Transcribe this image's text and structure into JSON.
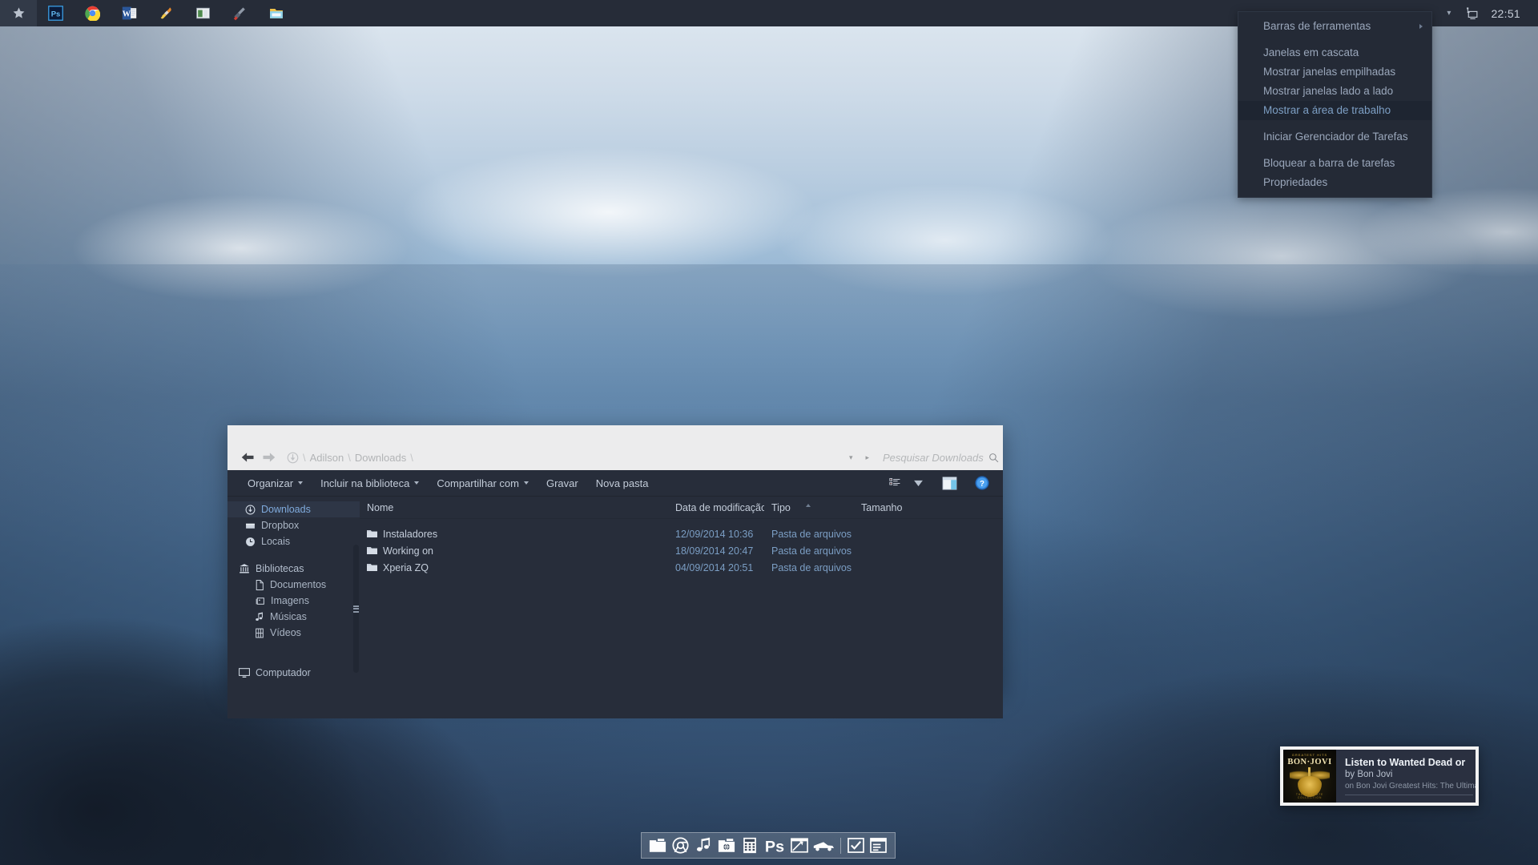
{
  "taskbar": {
    "icons": [
      {
        "name": "star-icon",
        "label": "Star"
      },
      {
        "name": "photoshop-icon",
        "label": "Adobe Photoshop"
      },
      {
        "name": "chrome-icon",
        "label": "Google Chrome"
      },
      {
        "name": "word-icon",
        "label": "Microsoft Word"
      },
      {
        "name": "paint-brush-icon",
        "label": "Paint"
      },
      {
        "name": "window-app-icon",
        "label": "Application"
      },
      {
        "name": "tools-icon",
        "label": "Tools"
      },
      {
        "name": "folder-explorer-icon",
        "label": "Windows Explorer"
      }
    ],
    "tray": {
      "show_hidden_label": "▾",
      "network_icon": "network-icon",
      "clock": "22:51"
    }
  },
  "context_menu": {
    "items": [
      {
        "label": "Barras de ferramentas",
        "submenu": true,
        "selected": false,
        "sep_after": true
      },
      {
        "label": "Janelas em cascata",
        "submenu": false,
        "selected": false,
        "sep_after": false
      },
      {
        "label": "Mostrar janelas empilhadas",
        "submenu": false,
        "selected": false,
        "sep_after": false
      },
      {
        "label": "Mostrar janelas lado a lado",
        "submenu": false,
        "selected": false,
        "sep_after": false
      },
      {
        "label": "Mostrar a área de trabalho",
        "submenu": false,
        "selected": true,
        "sep_after": true
      },
      {
        "label": "Iniciar Gerenciador de Tarefas",
        "submenu": false,
        "selected": false,
        "sep_after": true
      },
      {
        "label": "Bloquear a barra de tarefas",
        "submenu": false,
        "selected": false,
        "sep_after": false
      },
      {
        "label": "Propriedades",
        "submenu": false,
        "selected": false,
        "sep_after": false
      }
    ]
  },
  "explorer": {
    "address": {
      "back_icon": "back-arrow-icon",
      "forward_icon": "forward-arrow-icon",
      "location_icon": "downloads-icon",
      "crumbs": [
        "Adilson",
        "Downloads"
      ],
      "separator": "\\"
    },
    "search": {
      "placeholder": "Pesquisar Downloads",
      "icon": "search-icon"
    },
    "toolbar": {
      "buttons": [
        {
          "label": "Organizar",
          "caret": true
        },
        {
          "label": "Incluir na biblioteca",
          "caret": true
        },
        {
          "label": "Compartilhar com",
          "caret": true
        },
        {
          "label": "Gravar",
          "caret": false
        },
        {
          "label": "Nova pasta",
          "caret": false
        }
      ],
      "view_icon": "view-options-icon",
      "view_caret": "▾",
      "preview_icon": "preview-pane-icon",
      "help_icon": "help-icon"
    },
    "sidebar": {
      "items": [
        {
          "label": "Downloads",
          "icon": "download-circle-icon",
          "active": true,
          "indent": false,
          "head": false
        },
        {
          "label": "Dropbox",
          "icon": "dropbox-folder-icon",
          "active": false,
          "indent": false,
          "head": false
        },
        {
          "label": "Locais",
          "icon": "clock-icon",
          "active": false,
          "indent": false,
          "head": false
        },
        {
          "label": "Bibliotecas",
          "icon": "library-icon",
          "active": false,
          "indent": false,
          "head": true
        },
        {
          "label": "Documentos",
          "icon": "document-icon",
          "active": false,
          "indent": true,
          "head": false
        },
        {
          "label": "Imagens",
          "icon": "picture-icon",
          "active": false,
          "indent": true,
          "head": false
        },
        {
          "label": "Músicas",
          "icon": "music-note-icon",
          "active": false,
          "indent": true,
          "head": false
        },
        {
          "label": "Vídeos",
          "icon": "film-icon",
          "active": false,
          "indent": true,
          "head": false
        },
        {
          "label": "Computador",
          "icon": "computer-icon",
          "active": false,
          "indent": false,
          "head": true
        }
      ]
    },
    "columns": [
      {
        "key": "name",
        "label": "Nome",
        "sorted": false
      },
      {
        "key": "date",
        "label": "Data de modificação",
        "sorted": false
      },
      {
        "key": "type",
        "label": "Tipo",
        "sorted": true
      },
      {
        "key": "size",
        "label": "Tamanho",
        "sorted": false
      }
    ],
    "files": [
      {
        "name": "Instaladores",
        "date": "12/09/2014 10:36",
        "type": "Pasta de arquivos",
        "size": "",
        "icon": "folder-icon"
      },
      {
        "name": "Working on",
        "date": "18/09/2014 20:47",
        "type": "Pasta de arquivos",
        "size": "",
        "icon": "folder-icon"
      },
      {
        "name": "Xperia ZQ",
        "date": "04/09/2014 20:51",
        "type": "Pasta de arquivos",
        "size": "",
        "icon": "folder-icon"
      }
    ]
  },
  "notification": {
    "album_art": {
      "top_text": "GREATEST HITS",
      "artist_text": "BON·JOVI",
      "bottom_text": "THE ULTIMATE COLLECTION"
    },
    "title": "Listen to Wanted Dead or",
    "artist": "by Bon Jovi",
    "album": "on Bon Jovi Greatest Hits: The Ultimate"
  },
  "dock": {
    "items": [
      {
        "name": "folder-icon",
        "label": "Folder"
      },
      {
        "name": "chrome-icon",
        "label": "Chrome"
      },
      {
        "name": "music-note-icon",
        "label": "Music"
      },
      {
        "name": "web-browser-icon",
        "label": "Browser"
      },
      {
        "name": "calculator-icon",
        "label": "Calculator"
      },
      {
        "name": "photoshop-icon",
        "label": "Ps"
      },
      {
        "name": "snipping-tool-icon",
        "label": "Snipping Tool"
      },
      {
        "name": "car-icon",
        "label": "Car"
      },
      {
        "name": "checkbox-icon",
        "label": "Tasks"
      },
      {
        "name": "list-window-icon",
        "label": "List"
      }
    ],
    "separator_after_index": 7
  },
  "colors": {
    "taskbar_bg": "#262c38",
    "window_chrome": "#ececed",
    "window_body": "#272d3a",
    "accent_blue": "#7faadc",
    "muted_blue": "#7b9ec4",
    "menu_bg": "#242a36"
  }
}
